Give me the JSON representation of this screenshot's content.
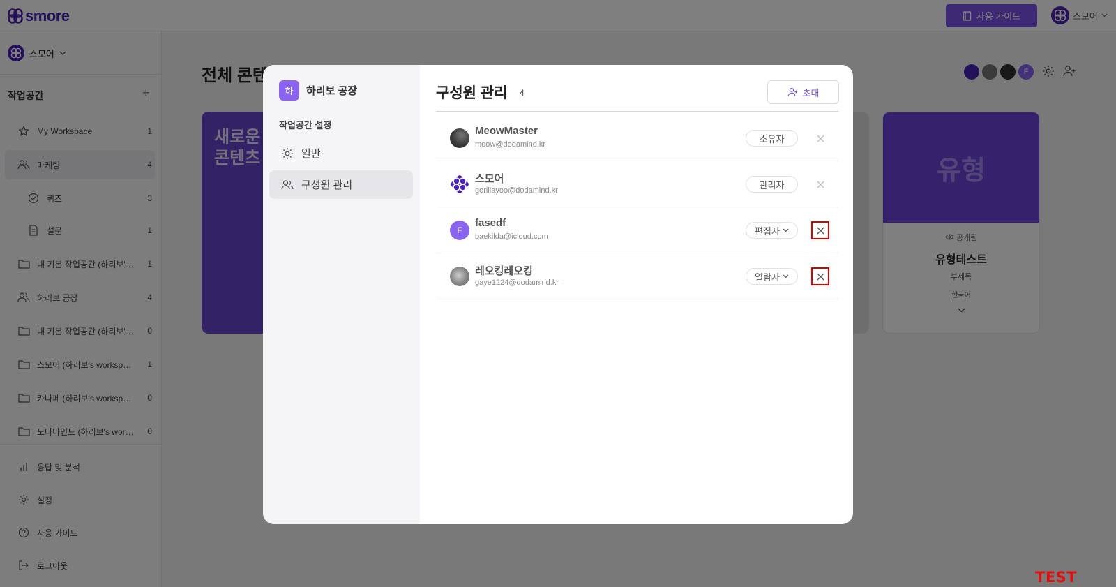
{
  "topbar": {
    "logo_text": "smore",
    "guide_button": "사용 가이드",
    "user_name": "스모어",
    "accent": "#7a52e8",
    "brand": "#4b23b5"
  },
  "sidebar": {
    "workspace_switch": "스모어",
    "section_title": "작업공간",
    "items": [
      {
        "label": "My Workspace",
        "count": "1",
        "icon": "star-icon"
      },
      {
        "label": "마케팅",
        "count": "4",
        "icon": "users-icon"
      },
      {
        "label": "퀴즈",
        "count": "3",
        "icon": "check-circle-icon"
      },
      {
        "label": "설문",
        "count": "1",
        "icon": "document-icon"
      },
      {
        "label": "내 기본 작업공간 (하리보'…",
        "count": "1",
        "icon": "folder-icon"
      },
      {
        "label": "하리보 공장",
        "count": "4",
        "icon": "users-icon"
      },
      {
        "label": "내 기본 작업공간 (하리보'…",
        "count": "0",
        "icon": "folder-icon"
      },
      {
        "label": "스모어 (하리보's worksp…",
        "count": "1",
        "icon": "folder-icon"
      },
      {
        "label": "카나페 (하리보's worksp…",
        "count": "0",
        "icon": "folder-icon"
      },
      {
        "label": "도다마인드 (하리보's wor…",
        "count": "0",
        "icon": "folder-icon"
      }
    ],
    "bottom": [
      {
        "label": "응답 및 분석",
        "icon": "bar-chart-icon"
      },
      {
        "label": "설정",
        "icon": "gear-icon"
      },
      {
        "label": "사용 가이드",
        "icon": "help-icon"
      },
      {
        "label": "로그아웃",
        "icon": "logout-icon"
      }
    ]
  },
  "main": {
    "title": "전체 콘텐",
    "card_left_text": "새로운\n콘텐츠",
    "card_right": {
      "thumb_text": "유형",
      "visibility": "공개됨",
      "title": "유형테스트",
      "subtitle": "부제목",
      "language": "한국어"
    },
    "member_initial": "F"
  },
  "modal": {
    "workspace_badge": "하",
    "workspace_name": "하리보 공장",
    "section_label": "작업공간 설정",
    "nav": [
      {
        "label": "일반",
        "icon": "gear-icon"
      },
      {
        "label": "구성원 관리",
        "icon": "users-icon"
      }
    ],
    "title": "구성원 관리",
    "count": "4",
    "invite_button": "초대",
    "members": [
      {
        "name": "MeowMaster",
        "email": "meow@dodamind.kr",
        "role": "소유자",
        "has_dropdown": false,
        "avatar": "photo-cat-dark"
      },
      {
        "name": "스모어",
        "email": "gorillayoo@dodamind.kr",
        "role": "관리자",
        "has_dropdown": false,
        "avatar": "smore-logo"
      },
      {
        "name": "fasedf",
        "email": "baekilda@icloud.com",
        "role": "편집자",
        "has_dropdown": true,
        "avatar": "F"
      },
      {
        "name": "레오킹레오킹",
        "email": "gaye1224@dodamind.kr",
        "role": "열람자",
        "has_dropdown": true,
        "avatar": "photo-cat-grey"
      }
    ]
  },
  "watermark": "TEST MODE"
}
